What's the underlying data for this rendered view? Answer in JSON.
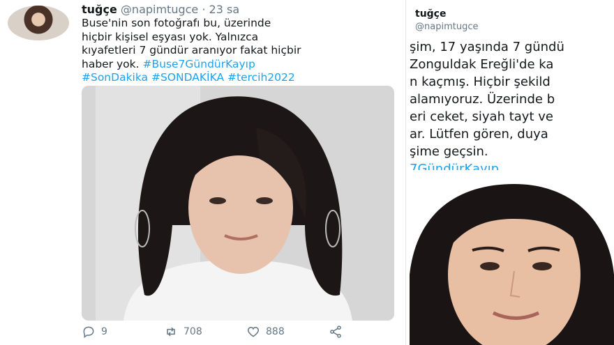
{
  "left_tweet": {
    "display_name": "tuğçe",
    "handle": "@napimtugce",
    "separator": "·",
    "time": "23 sa",
    "text_lines": [
      "Buse'nin son fotoğrafı bu, üzerinde",
      "hiçbir kişisel eşyası yok. Yalnızca",
      "kıyafetleri 7 gündür aranıyor fakat hiçbir",
      "haber yok."
    ],
    "hashtag_inline": "#Buse7GündürKayıp",
    "hashtag_line": "#SonDakika #SONDAKİKA #tercih2022",
    "actions": {
      "reply_count": "9",
      "retweet_count": "708",
      "like_count": "888"
    }
  },
  "right_tweet": {
    "display_name": "tuğçe",
    "handle": "@napimtugce",
    "text_lines": [
      "şim, 17 yaşında 7 gündü",
      "Zonguldak Ereğli'de ka",
      "n kaçmış. Hiçbir şekild",
      "alamıyoruz. Üzerinde b",
      "eri ceket, siyah tayt ve",
      "ar. Lütfen gören, duya",
      "şime geçsin."
    ],
    "hashtag": "7GündürKayıp"
  },
  "colors": {
    "link": "#1da1f2",
    "muted": "#657786",
    "text": "#14171a"
  }
}
